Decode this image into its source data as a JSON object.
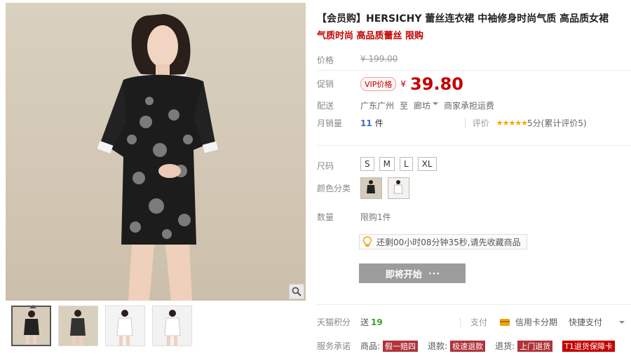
{
  "product": {
    "title": "【会员购】HERSICHY 蕾丝连衣裙 中袖修身时尚气质 高品质女裙",
    "subtitle": "气质时尚 高品质蕾丝 限购"
  },
  "price": {
    "label": "价格",
    "original": "¥ 199.00",
    "promo_label": "促销",
    "vip_tag": "VIP价格",
    "currency": "¥",
    "promo_value": "39.80"
  },
  "shipping": {
    "label": "配送",
    "from": "广东广州",
    "to_word": "至",
    "destination": "廊坊",
    "fee": "商家承担运费"
  },
  "sales": {
    "label": "月销量",
    "count": "11",
    "unit": "件",
    "rating_label": "评价",
    "stars": "★★★★★",
    "rating_text": "5分(累计评价5)"
  },
  "sku": {
    "size_label": "尺码",
    "sizes": [
      "S",
      "M",
      "L",
      "XL"
    ],
    "color_label": "颜色分类"
  },
  "quantity": {
    "label": "数量",
    "limit": "限购1件"
  },
  "notice": {
    "text": "还剩00小时08分钟35秒,请先收藏商品"
  },
  "action": {
    "start_label": "即将开始",
    "dots": "• • •"
  },
  "points": {
    "label": "天猫积分",
    "prefix": "送",
    "value": "19"
  },
  "payment": {
    "label": "支付",
    "credit": "信用卡分期",
    "quick": "快捷支付"
  },
  "service": {
    "label": "服务承诺",
    "goods": "商品:",
    "goods_tag": "假一赔四",
    "return": "退款:",
    "return_tag": "极速退款",
    "exchange": "退货:",
    "exchange_tag": "上门退货",
    "card": "T1退货保障卡"
  },
  "colors": {
    "accent": "#c40000",
    "link": "#3a6ac6",
    "star": "#f4a700",
    "button_disabled": "#9c9c9c"
  },
  "icons": [
    "zoom-icon",
    "bulb-icon",
    "card-icon",
    "chevron-down-icon"
  ]
}
